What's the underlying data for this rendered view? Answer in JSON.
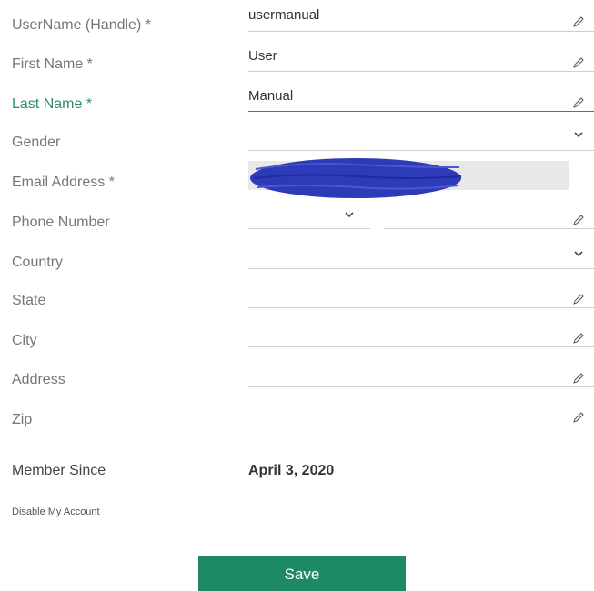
{
  "form": {
    "fields": {
      "username": {
        "label": "UserName (Handle) *",
        "value": "usermanual"
      },
      "first_name": {
        "label": "First Name *",
        "value": "User"
      },
      "last_name": {
        "label": "Last Name *",
        "value": "Manual"
      },
      "gender": {
        "label": "Gender",
        "value": ""
      },
      "email": {
        "label": "Email Address *",
        "value": ""
      },
      "phone": {
        "label": "Phone Number",
        "code_value": "",
        "value": ""
      },
      "country": {
        "label": "Country",
        "value": ""
      },
      "state": {
        "label": "State",
        "value": ""
      },
      "city": {
        "label": "City",
        "value": ""
      },
      "address": {
        "label": "Address",
        "value": ""
      },
      "zip": {
        "label": "Zip",
        "value": ""
      }
    },
    "member_since": {
      "label": "Member Since",
      "value": "April 3, 2020"
    },
    "disable_link": "Disable My Account",
    "save_label": "Save"
  },
  "colors": {
    "accent": "#2e8b6e",
    "button": "#1e8a64",
    "redaction": "#2e3bb8"
  },
  "icons": {
    "edit": "pencil-icon",
    "dropdown": "chevron-down-icon"
  }
}
